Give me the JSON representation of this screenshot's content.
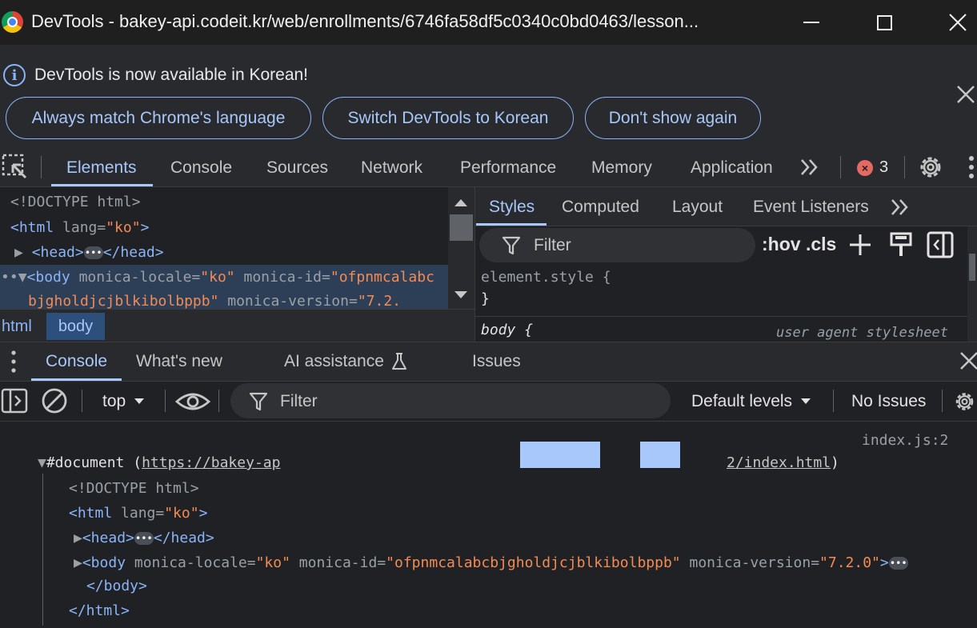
{
  "window": {
    "title": "DevTools - bakey-api.codeit.kr/web/enrollments/6746fa58df5c0340c0bd0463/lesson..."
  },
  "infobar": {
    "message": "DevTools is now available in Korean!",
    "buttons": {
      "match": "Always match Chrome's language",
      "switch": "Switch DevTools to Korean",
      "dont_show": "Don't show again"
    }
  },
  "main_tabs": [
    "Elements",
    "Console",
    "Sources",
    "Network",
    "Performance",
    "Memory",
    "Application"
  ],
  "error_count": "3",
  "dom_tree": {
    "doctype": "<!DOCTYPE html>",
    "html_open": "<html ",
    "html_attr": "lang=",
    "html_val": "\"ko\"",
    "html_close": ">",
    "head_open": "<head>",
    "head_close": "</head>",
    "body_open": "<body ",
    "body_attr1": "monica-locale=",
    "body_val1": "\"ko\"",
    "body_attr2": " monica-id=",
    "body_val2a": "\"ofpnmcalabc",
    "body_val2b": "bjgholdjcjblkibolbppb\"",
    "body_attr3": " monica-version=",
    "body_val3": "\"7.2."
  },
  "breadcrumb": [
    "html",
    "body"
  ],
  "styles": {
    "tabs": [
      "Styles",
      "Computed",
      "Layout",
      "Event Listeners"
    ],
    "filter_placeholder": "Filter",
    "hov_cls": ":hov .cls",
    "rule1_selector": "element.style {",
    "rule1_close": "}",
    "rule2_selector": "body {",
    "rule2_source": "user agent stylesheet"
  },
  "drawer": {
    "tabs": [
      "Console",
      "What's new",
      "AI assistance",
      "Issues"
    ],
    "context": "top",
    "filter_placeholder": "Filter",
    "levels": "Default levels",
    "issues": "No Issues"
  },
  "console_output": {
    "source": "index.js:2",
    "doc_label": "#document (",
    "doc_link_start": "https://bakey-ap",
    "doc_link_end": "2/index.html",
    "doc_close": ")",
    "doctype": "<!DOCTYPE html>",
    "html_open": "<html ",
    "html_attr": "lang=",
    "html_val": "\"ko\"",
    "html_close": ">",
    "head_open": "<head>",
    "head_close": "</head>",
    "body_open": "<body ",
    "body_attr1": "monica-locale=",
    "body_val1": "\"ko\"",
    "body_attr2": " monica-id=",
    "body_val2": "\"ofpnmcalabcbjgholdjcjblkibolbppb\"",
    "body_attr3": " monica-version=",
    "body_val3": "\"7.2.0\"",
    "body_gt": ">",
    "body_end": "</body>",
    "html_end": "</html>"
  },
  "colors": {
    "accent": "#a8c7fa",
    "background": "#202124",
    "error": "#e46962"
  }
}
